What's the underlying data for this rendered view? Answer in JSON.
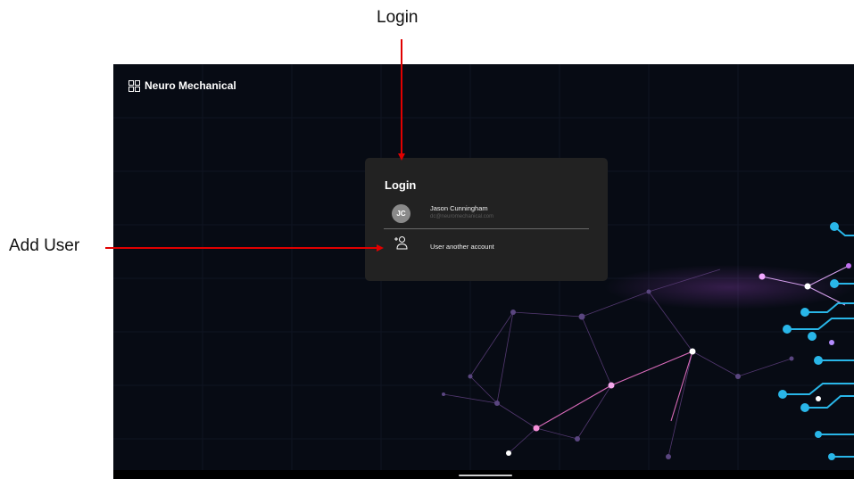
{
  "annotations": {
    "login_label": "Login",
    "add_user_label": "Add User",
    "arrow_color": "#e00000"
  },
  "app": {
    "brand_name": "Neuro Mechanical",
    "brand_icon": "grid-icon"
  },
  "login_card": {
    "title": "Login",
    "account": {
      "initials": "JC",
      "name": "Jason Cunningham",
      "email": "dc@neuromechanical.com"
    },
    "add_account_icon": "add-user-icon",
    "add_account_label": "User another account"
  },
  "colors": {
    "background": "#070b14",
    "card": "#222222",
    "avatar": "#8a8a8a",
    "network_purple": "#c36fe0",
    "network_cyan": "#29b6e8"
  }
}
